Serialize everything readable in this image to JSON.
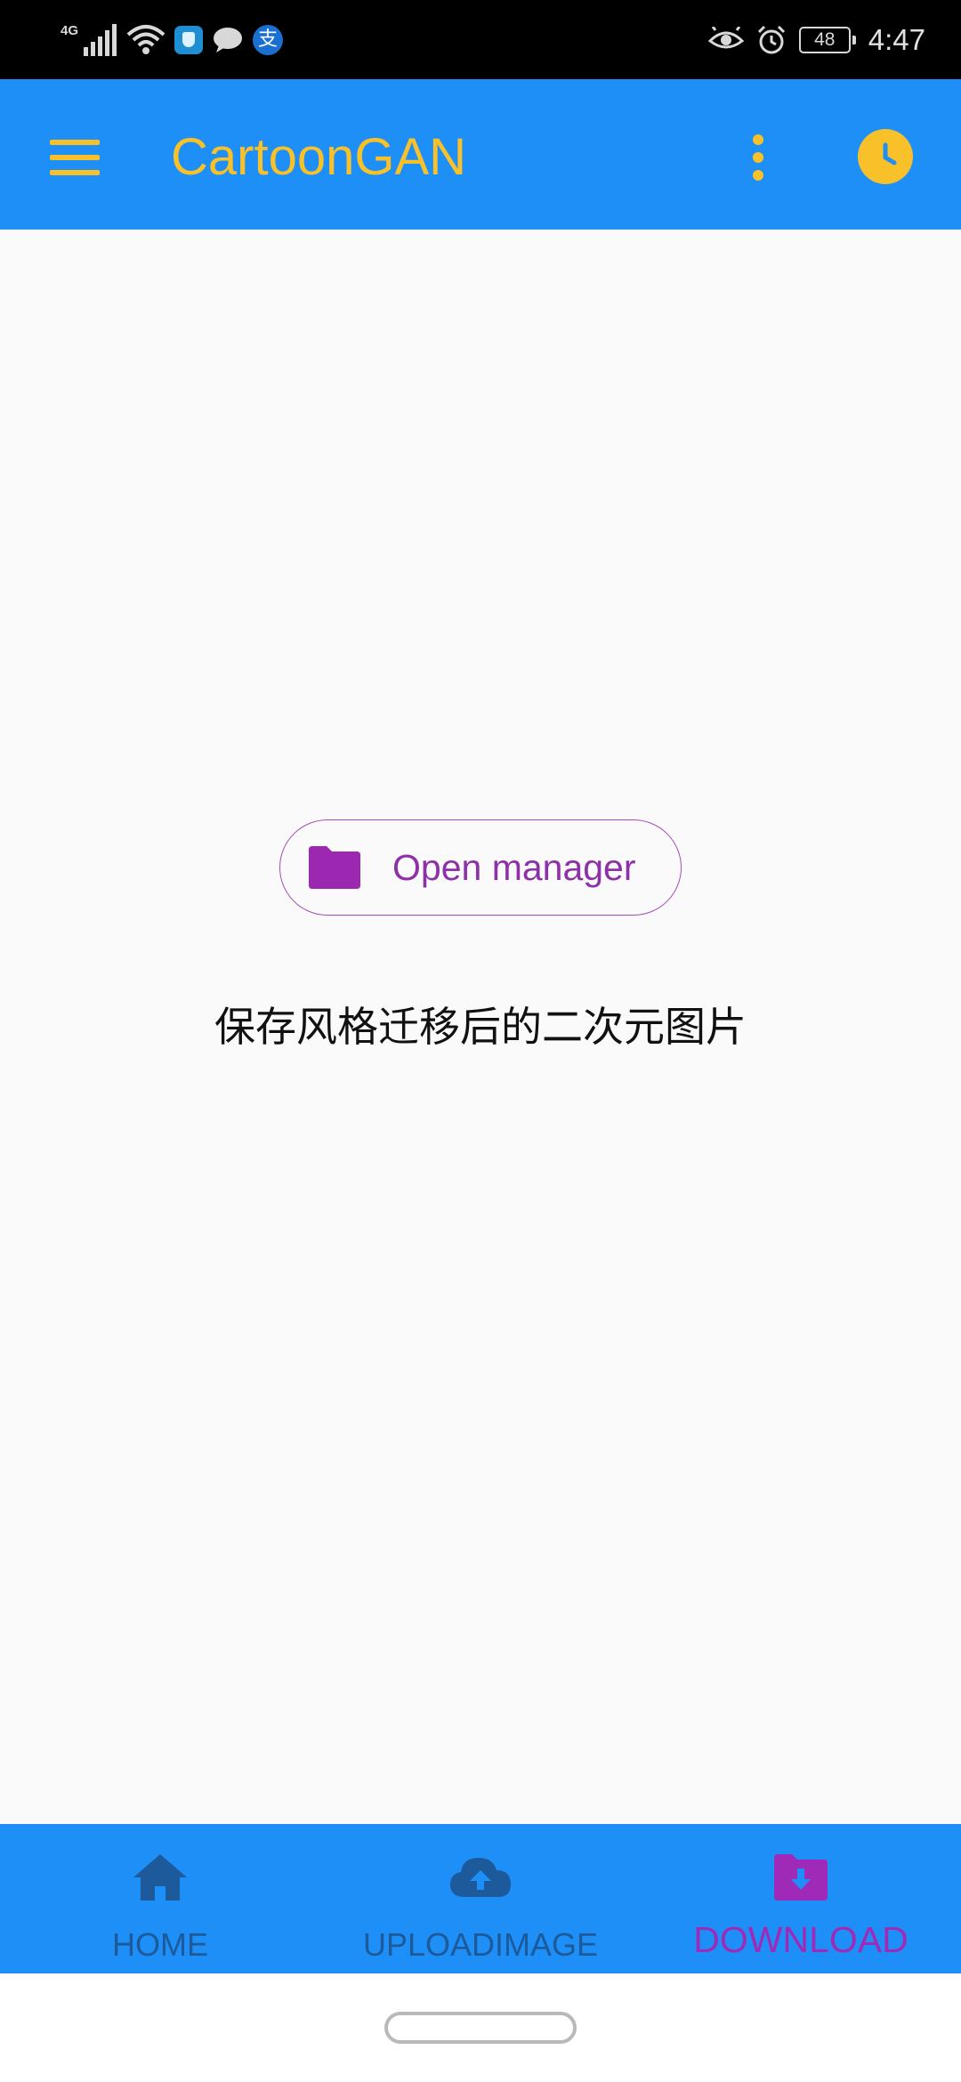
{
  "status_bar": {
    "network_type": "4G",
    "battery": "48",
    "time": "4:47",
    "icons": [
      "signal-icon",
      "wifi-icon",
      "security-app-icon",
      "chat-icon",
      "alipay-icon",
      "eye-comfort-icon",
      "alarm-icon",
      "battery-icon"
    ],
    "alipay_glyph": "支"
  },
  "app_bar": {
    "title": "CartoonGAN",
    "background_color": "#1e8ff7",
    "accent_color": "#f8c12a",
    "icons": [
      "menu-icon",
      "more-vert-icon",
      "clock-icon"
    ]
  },
  "main": {
    "open_manager_label": "Open manager",
    "open_manager_icon": "folder-icon",
    "button_color": "#8e31a8",
    "caption": "保存风格迁移后的二次元图片"
  },
  "bottom_nav": {
    "items": [
      {
        "label": "HOME",
        "icon": "home-icon",
        "active": false
      },
      {
        "label": "UPLOADIMAGE",
        "icon": "cloud-upload-icon",
        "active": false
      },
      {
        "label": "DOWNLOAD",
        "icon": "folder-download-icon",
        "active": true
      }
    ],
    "inactive_color": "#1d5a9c",
    "active_color": "#a02ab8"
  }
}
